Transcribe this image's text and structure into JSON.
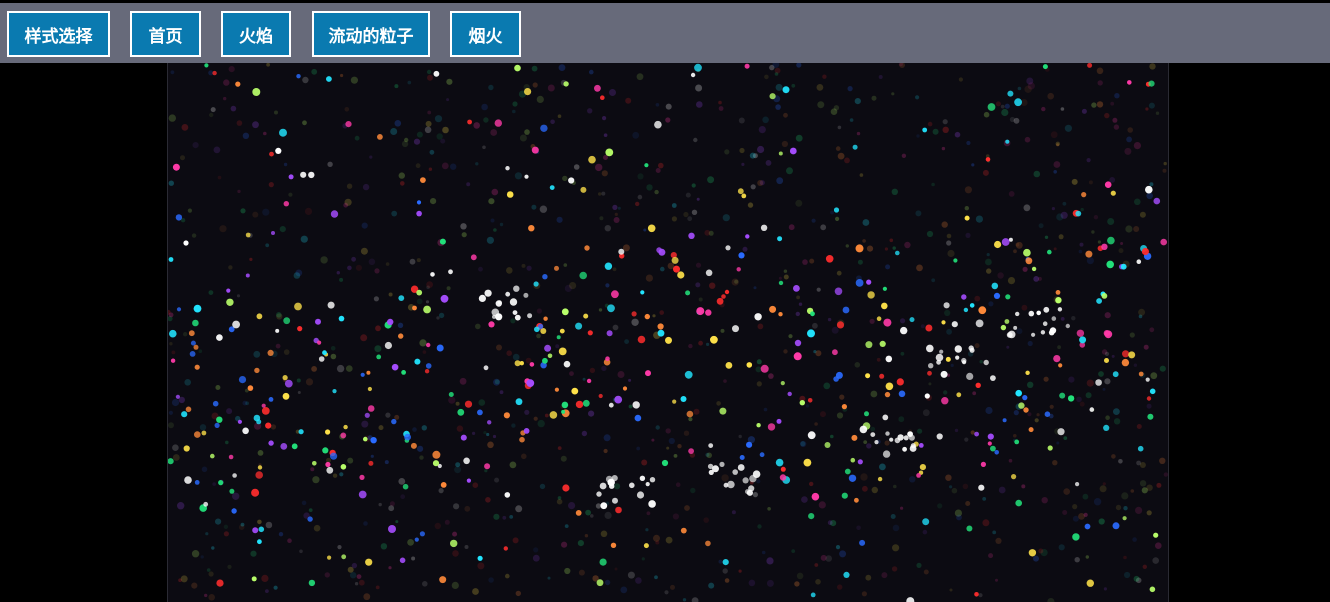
{
  "nav": {
    "buttons": [
      {
        "label": "样式选择"
      },
      {
        "label": "首页"
      },
      {
        "label": "火焰"
      },
      {
        "label": "流动的粒子"
      },
      {
        "label": "烟火"
      }
    ]
  },
  "colors": {
    "topbar": "#676a7a",
    "button_bg": "#0a7ab0",
    "button_border": "#ffffff",
    "page_bg": "#000000",
    "canvas_bg": "#0c0b12",
    "particle_palette": [
      "#22e07a",
      "#ff3aa8",
      "#2a6bff",
      "#ffe24a",
      "#a64dff",
      "#22e5ff",
      "#ff2d2d",
      "#ff8a3a",
      "#b9ff6a",
      "#ffffff"
    ]
  },
  "canvas": {
    "name": "flowing-particles-canvas"
  }
}
